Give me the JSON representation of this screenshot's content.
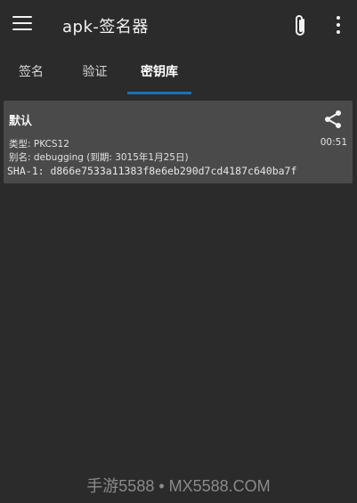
{
  "appbar": {
    "title": "apk-签名器",
    "icons": [
      "menu-icon",
      "paperclip-icon",
      "more-vert-icon"
    ]
  },
  "tabs": [
    {
      "label": "签名",
      "active": false
    },
    {
      "label": "验证",
      "active": false
    },
    {
      "label": "密钥库",
      "active": true
    }
  ],
  "keystore": {
    "name": "默认",
    "type_line": "类型: PKCS12",
    "alias_line": "别名: debugging (到期: 3015年1月25日)",
    "time": "00:51",
    "sha1_line": "SHA-1: d866e7533a11383f8e6eb290d7cd4187c640ba7f",
    "share_icon": "share-icon"
  },
  "watermark": "手游5588 • MX5588.COM",
  "colors": {
    "background": "#2b2b2b",
    "card": "#4a4a4a",
    "accent": "#1f6fb2"
  }
}
